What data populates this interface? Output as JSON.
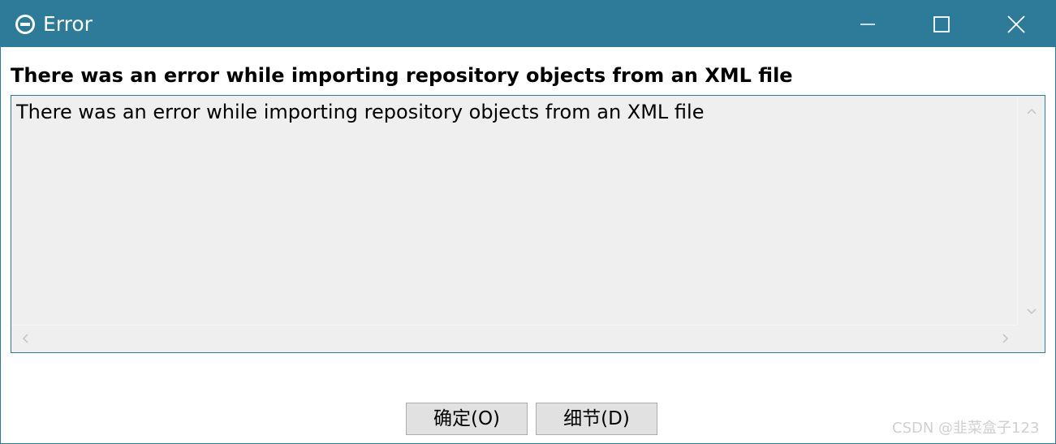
{
  "window": {
    "title": "Error",
    "title_icon": "error-circle-icon",
    "controls": {
      "minimize_icon": "minimize-icon",
      "maximize_icon": "maximize-icon",
      "close_icon": "close-icon"
    }
  },
  "dialog": {
    "heading": "There was an error while importing repository objects from an XML file",
    "message": "There was an error while importing repository objects from an XML file"
  },
  "buttons": {
    "ok": "确定(O)",
    "details": "细节(D)"
  },
  "watermark": "CSDN @韭菜盒子123",
  "colors": {
    "titlebar": "#2d7b99",
    "text_area_bg": "#efefef",
    "button_bg": "#e1e1e1"
  }
}
